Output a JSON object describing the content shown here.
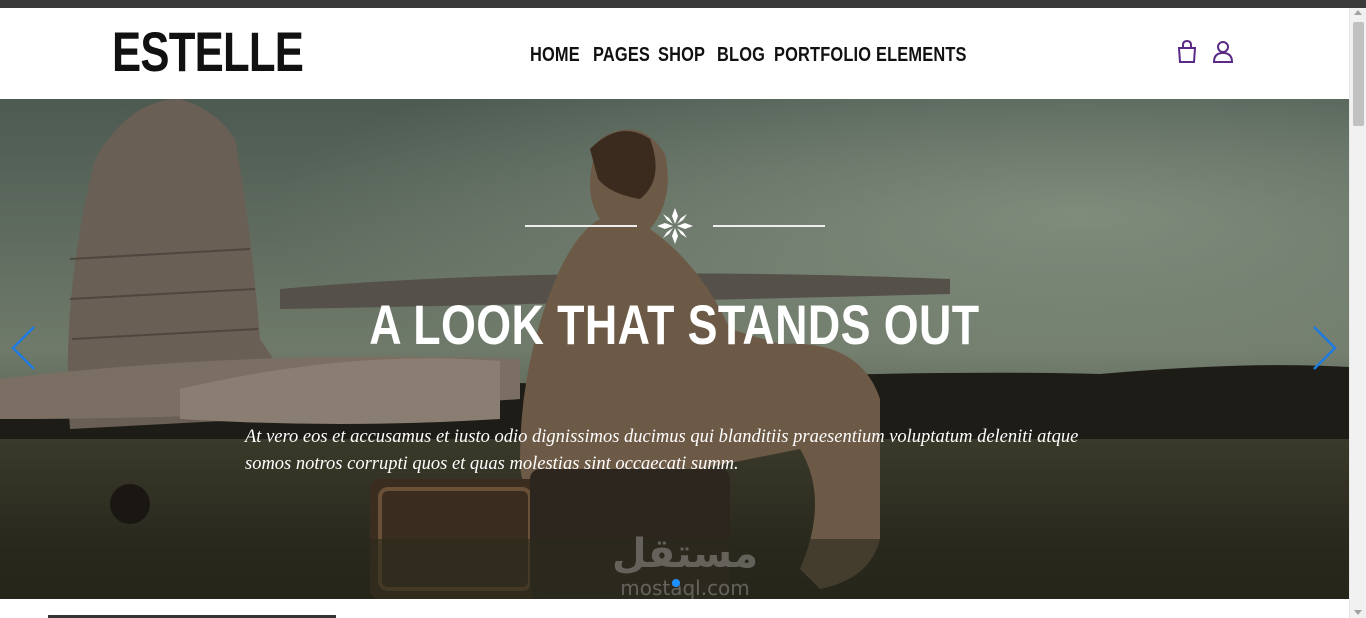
{
  "header": {
    "logo": "ESTELLE",
    "nav": [
      {
        "label": "HOME"
      },
      {
        "label": "PAGES"
      },
      {
        "label": "SHOP"
      },
      {
        "label": "BLOG"
      },
      {
        "label": "PORTFOLIO"
      },
      {
        "label": "ELEMENTS"
      }
    ],
    "icons": [
      "shopping-bag-icon",
      "user-icon"
    ],
    "icon_color": "#5b2a86"
  },
  "hero": {
    "title": "A LOOK THAT STANDS OUT",
    "text": "At vero eos et accusamus et iusto odio dignissimos ducimus qui blanditiis praesentium voluptatum deleniti atque somos notros corrupti quos et quas molestias sint occaecati summ.",
    "arrow_color": "#1e7be0",
    "active_dot": 1
  },
  "watermark": {
    "arabic": "مستقل",
    "latin": "mostaql.com"
  }
}
